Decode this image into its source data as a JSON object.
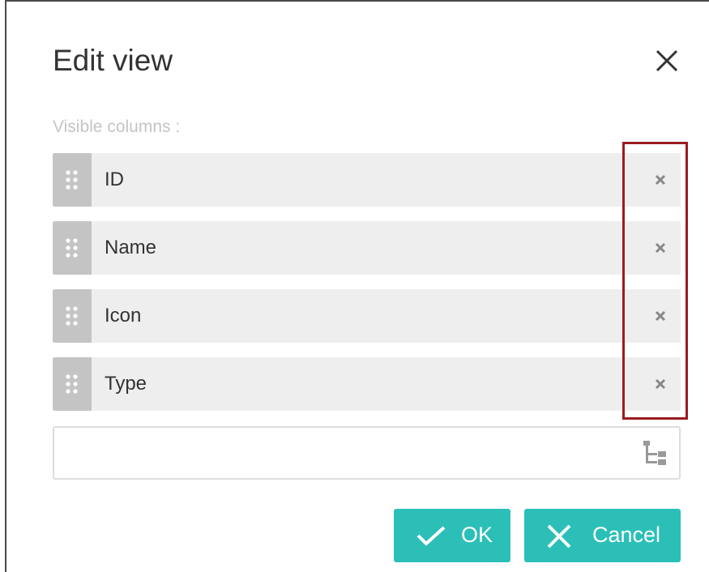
{
  "dialog": {
    "title": "Edit view",
    "section_label": "Visible columns :",
    "columns": [
      {
        "label": "ID"
      },
      {
        "label": "Name"
      },
      {
        "label": "Icon"
      },
      {
        "label": "Type"
      }
    ],
    "add_column_input": {
      "value": "",
      "placeholder": ""
    },
    "buttons": {
      "ok_label": "OK",
      "cancel_label": "Cancel"
    }
  },
  "colors": {
    "accent": "#2bbfb8",
    "highlight_border": "#9b1b22",
    "row_background": "#eeeeee",
    "handle_background": "#c4c4c4"
  },
  "icons": {
    "close": "close-icon",
    "drag": "drag-handle-icon",
    "remove": "remove-icon",
    "tree": "tree-structure-icon",
    "ok": "check-icon",
    "cancel": "cancel-x-icon"
  }
}
